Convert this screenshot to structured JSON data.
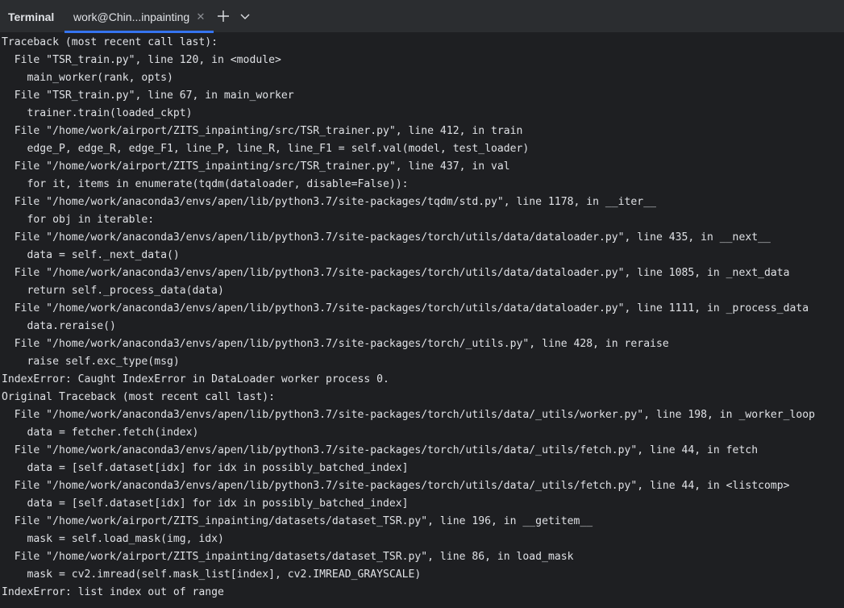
{
  "panel_title": "Terminal",
  "tab": {
    "label": "work@Chin...inpainting",
    "close_icon": "close-icon"
  },
  "toolbar": {
    "add_icon": "plus-icon",
    "menu_icon": "chevron-down-icon"
  },
  "colors": {
    "background": "#1e1f22",
    "tabbar": "#2b2d30",
    "accent": "#3574f0",
    "text": "#dfe1e5"
  },
  "terminal": {
    "lines": [
      "Traceback (most recent call last):",
      "  File \"TSR_train.py\", line 120, in <module>",
      "    main_worker(rank, opts)",
      "  File \"TSR_train.py\", line 67, in main_worker",
      "    trainer.train(loaded_ckpt)",
      "  File \"/home/work/airport/ZITS_inpainting/src/TSR_trainer.py\", line 412, in train",
      "    edge_P, edge_R, edge_F1, line_P, line_R, line_F1 = self.val(model, test_loader)",
      "  File \"/home/work/airport/ZITS_inpainting/src/TSR_trainer.py\", line 437, in val",
      "    for it, items in enumerate(tqdm(dataloader, disable=False)):",
      "  File \"/home/work/anaconda3/envs/apen/lib/python3.7/site-packages/tqdm/std.py\", line 1178, in __iter__",
      "    for obj in iterable:",
      "  File \"/home/work/anaconda3/envs/apen/lib/python3.7/site-packages/torch/utils/data/dataloader.py\", line 435, in __next__",
      "    data = self._next_data()",
      "  File \"/home/work/anaconda3/envs/apen/lib/python3.7/site-packages/torch/utils/data/dataloader.py\", line 1085, in _next_data",
      "    return self._process_data(data)",
      "  File \"/home/work/anaconda3/envs/apen/lib/python3.7/site-packages/torch/utils/data/dataloader.py\", line 1111, in _process_data",
      "    data.reraise()",
      "  File \"/home/work/anaconda3/envs/apen/lib/python3.7/site-packages/torch/_utils.py\", line 428, in reraise",
      "    raise self.exc_type(msg)",
      "IndexError: Caught IndexError in DataLoader worker process 0.",
      "Original Traceback (most recent call last):",
      "  File \"/home/work/anaconda3/envs/apen/lib/python3.7/site-packages/torch/utils/data/_utils/worker.py\", line 198, in _worker_loop",
      "    data = fetcher.fetch(index)",
      "  File \"/home/work/anaconda3/envs/apen/lib/python3.7/site-packages/torch/utils/data/_utils/fetch.py\", line 44, in fetch",
      "    data = [self.dataset[idx] for idx in possibly_batched_index]",
      "  File \"/home/work/anaconda3/envs/apen/lib/python3.7/site-packages/torch/utils/data/_utils/fetch.py\", line 44, in <listcomp>",
      "    data = [self.dataset[idx] for idx in possibly_batched_index]",
      "  File \"/home/work/airport/ZITS_inpainting/datasets/dataset_TSR.py\", line 196, in __getitem__",
      "    mask = self.load_mask(img, idx)",
      "  File \"/home/work/airport/ZITS_inpainting/datasets/dataset_TSR.py\", line 86, in load_mask",
      "    mask = cv2.imread(self.mask_list[index], cv2.IMREAD_GRAYSCALE)",
      "IndexError: list index out of range"
    ]
  }
}
